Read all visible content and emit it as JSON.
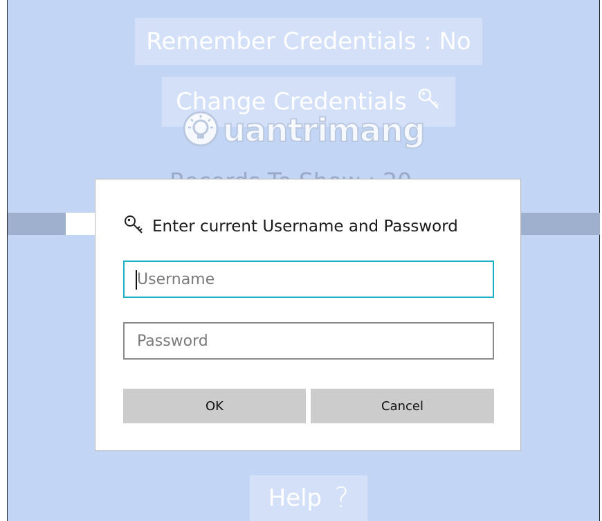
{
  "background": {
    "remember_label": "Remember Credentials : No",
    "change_label": "Change Credentials",
    "records_label": "Records To Show : 20",
    "help_label": "Help",
    "help_glyph": "?",
    "watermark_text": "uantrimang"
  },
  "dialog": {
    "title": "Enter current Username and Password",
    "username": {
      "placeholder": "Username",
      "value": ""
    },
    "password": {
      "placeholder": "Password",
      "value": ""
    },
    "ok_label": "OK",
    "cancel_label": "Cancel"
  },
  "colors": {
    "background": "#c2d5f5",
    "focus_border": "#1bb3c4",
    "button_gray": "#cccccc"
  },
  "icons": [
    "key-icon",
    "help-icon",
    "lightbulb-icon"
  ]
}
